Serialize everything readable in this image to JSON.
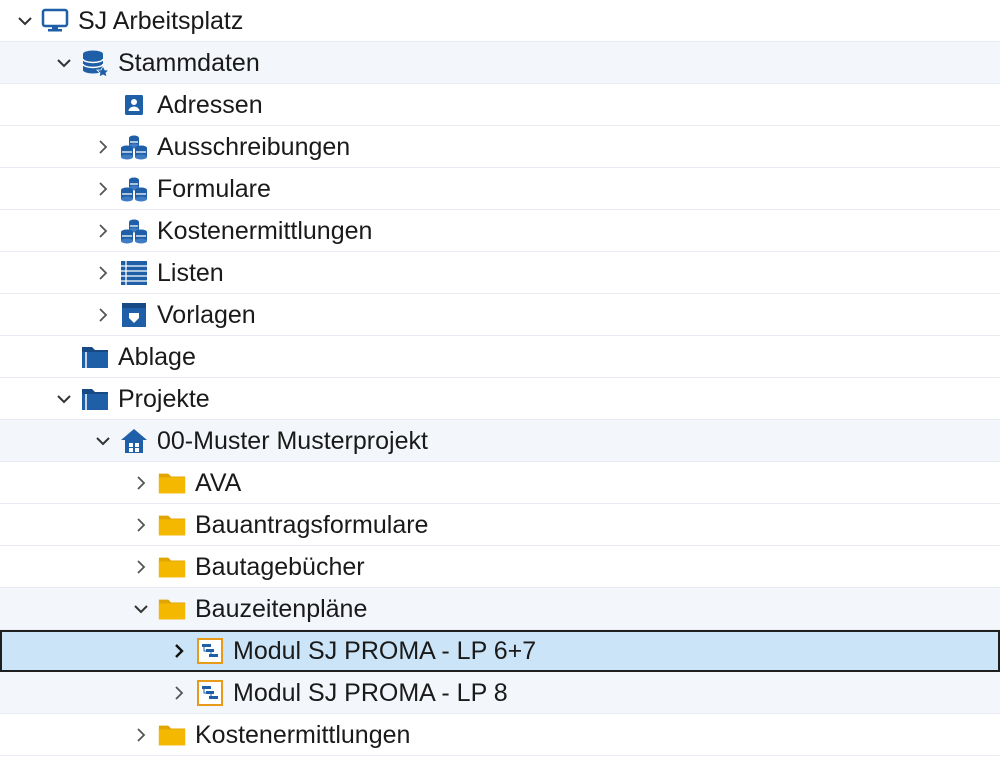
{
  "tree": {
    "items": [
      {
        "label": "SJ Arbeitsplatz",
        "icon": "computer-icon",
        "expanded": true
      },
      {
        "label": "Stammdaten",
        "icon": "database-icon",
        "expanded": true
      },
      {
        "label": "Adressen",
        "icon": "contact-card-icon"
      },
      {
        "label": "Ausschreibungen",
        "icon": "stacked-coins-icon",
        "expanded": false
      },
      {
        "label": "Formulare",
        "icon": "stacked-coins-icon",
        "expanded": false
      },
      {
        "label": "Kostenermittlungen",
        "icon": "stacked-coins-icon",
        "expanded": false
      },
      {
        "label": "Listen",
        "icon": "list-icon",
        "expanded": false
      },
      {
        "label": "Vorlagen",
        "icon": "template-icon",
        "expanded": false
      },
      {
        "label": "Ablage",
        "icon": "folder-dark-icon"
      },
      {
        "label": "Projekte",
        "icon": "folder-dark-icon",
        "expanded": true
      },
      {
        "label": "00-Muster Musterprojekt",
        "icon": "house-icon",
        "expanded": true
      },
      {
        "label": "AVA",
        "icon": "folder-yellow-icon",
        "expanded": false
      },
      {
        "label": "Bauantragsformulare",
        "icon": "folder-yellow-icon",
        "expanded": false
      },
      {
        "label": "Bautagebücher",
        "icon": "folder-yellow-icon",
        "expanded": false
      },
      {
        "label": "Bauzeitenpläne",
        "icon": "folder-yellow-icon",
        "expanded": true
      },
      {
        "label": "Modul SJ PROMA - LP 6+7",
        "icon": "gantt-schedule-icon",
        "expanded": false,
        "selected": true
      },
      {
        "label": "Modul SJ PROMA - LP 8",
        "icon": "gantt-schedule-icon",
        "expanded": false
      },
      {
        "label": "Kostenermittlungen",
        "icon": "folder-yellow-icon",
        "expanded": false
      }
    ]
  },
  "colors": {
    "selection": "#cce4f7",
    "alt_row": "#f3f6fa",
    "icon_blue": "#1f5fa8",
    "folder_yellow": "#f5b800"
  }
}
